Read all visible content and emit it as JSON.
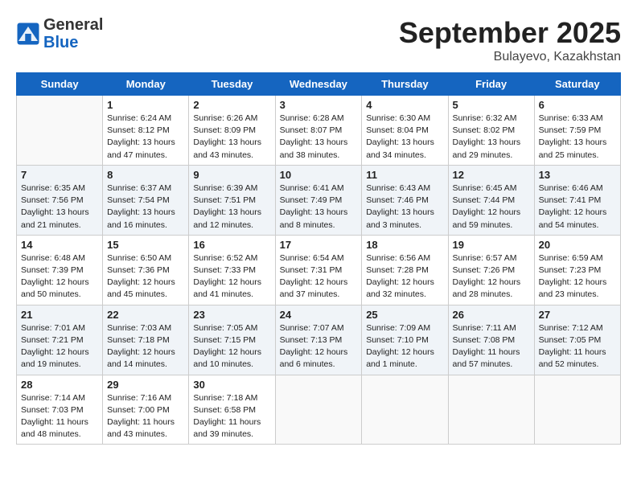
{
  "header": {
    "logo": {
      "general": "General",
      "blue": "Blue"
    },
    "title": "September 2025",
    "location": "Bulayevo, Kazakhstan"
  },
  "days_of_week": [
    "Sunday",
    "Monday",
    "Tuesday",
    "Wednesday",
    "Thursday",
    "Friday",
    "Saturday"
  ],
  "weeks": [
    [
      {
        "day": null,
        "info": null
      },
      {
        "day": "1",
        "sunrise": "Sunrise: 6:24 AM",
        "sunset": "Sunset: 8:12 PM",
        "daylight": "Daylight: 13 hours and 47 minutes."
      },
      {
        "day": "2",
        "sunrise": "Sunrise: 6:26 AM",
        "sunset": "Sunset: 8:09 PM",
        "daylight": "Daylight: 13 hours and 43 minutes."
      },
      {
        "day": "3",
        "sunrise": "Sunrise: 6:28 AM",
        "sunset": "Sunset: 8:07 PM",
        "daylight": "Daylight: 13 hours and 38 minutes."
      },
      {
        "day": "4",
        "sunrise": "Sunrise: 6:30 AM",
        "sunset": "Sunset: 8:04 PM",
        "daylight": "Daylight: 13 hours and 34 minutes."
      },
      {
        "day": "5",
        "sunrise": "Sunrise: 6:32 AM",
        "sunset": "Sunset: 8:02 PM",
        "daylight": "Daylight: 13 hours and 29 minutes."
      },
      {
        "day": "6",
        "sunrise": "Sunrise: 6:33 AM",
        "sunset": "Sunset: 7:59 PM",
        "daylight": "Daylight: 13 hours and 25 minutes."
      }
    ],
    [
      {
        "day": "7",
        "sunrise": "Sunrise: 6:35 AM",
        "sunset": "Sunset: 7:56 PM",
        "daylight": "Daylight: 13 hours and 21 minutes."
      },
      {
        "day": "8",
        "sunrise": "Sunrise: 6:37 AM",
        "sunset": "Sunset: 7:54 PM",
        "daylight": "Daylight: 13 hours and 16 minutes."
      },
      {
        "day": "9",
        "sunrise": "Sunrise: 6:39 AM",
        "sunset": "Sunset: 7:51 PM",
        "daylight": "Daylight: 13 hours and 12 minutes."
      },
      {
        "day": "10",
        "sunrise": "Sunrise: 6:41 AM",
        "sunset": "Sunset: 7:49 PM",
        "daylight": "Daylight: 13 hours and 8 minutes."
      },
      {
        "day": "11",
        "sunrise": "Sunrise: 6:43 AM",
        "sunset": "Sunset: 7:46 PM",
        "daylight": "Daylight: 13 hours and 3 minutes."
      },
      {
        "day": "12",
        "sunrise": "Sunrise: 6:45 AM",
        "sunset": "Sunset: 7:44 PM",
        "daylight": "Daylight: 12 hours and 59 minutes."
      },
      {
        "day": "13",
        "sunrise": "Sunrise: 6:46 AM",
        "sunset": "Sunset: 7:41 PM",
        "daylight": "Daylight: 12 hours and 54 minutes."
      }
    ],
    [
      {
        "day": "14",
        "sunrise": "Sunrise: 6:48 AM",
        "sunset": "Sunset: 7:39 PM",
        "daylight": "Daylight: 12 hours and 50 minutes."
      },
      {
        "day": "15",
        "sunrise": "Sunrise: 6:50 AM",
        "sunset": "Sunset: 7:36 PM",
        "daylight": "Daylight: 12 hours and 45 minutes."
      },
      {
        "day": "16",
        "sunrise": "Sunrise: 6:52 AM",
        "sunset": "Sunset: 7:33 PM",
        "daylight": "Daylight: 12 hours and 41 minutes."
      },
      {
        "day": "17",
        "sunrise": "Sunrise: 6:54 AM",
        "sunset": "Sunset: 7:31 PM",
        "daylight": "Daylight: 12 hours and 37 minutes."
      },
      {
        "day": "18",
        "sunrise": "Sunrise: 6:56 AM",
        "sunset": "Sunset: 7:28 PM",
        "daylight": "Daylight: 12 hours and 32 minutes."
      },
      {
        "day": "19",
        "sunrise": "Sunrise: 6:57 AM",
        "sunset": "Sunset: 7:26 PM",
        "daylight": "Daylight: 12 hours and 28 minutes."
      },
      {
        "day": "20",
        "sunrise": "Sunrise: 6:59 AM",
        "sunset": "Sunset: 7:23 PM",
        "daylight": "Daylight: 12 hours and 23 minutes."
      }
    ],
    [
      {
        "day": "21",
        "sunrise": "Sunrise: 7:01 AM",
        "sunset": "Sunset: 7:21 PM",
        "daylight": "Daylight: 12 hours and 19 minutes."
      },
      {
        "day": "22",
        "sunrise": "Sunrise: 7:03 AM",
        "sunset": "Sunset: 7:18 PM",
        "daylight": "Daylight: 12 hours and 14 minutes."
      },
      {
        "day": "23",
        "sunrise": "Sunrise: 7:05 AM",
        "sunset": "Sunset: 7:15 PM",
        "daylight": "Daylight: 12 hours and 10 minutes."
      },
      {
        "day": "24",
        "sunrise": "Sunrise: 7:07 AM",
        "sunset": "Sunset: 7:13 PM",
        "daylight": "Daylight: 12 hours and 6 minutes."
      },
      {
        "day": "25",
        "sunrise": "Sunrise: 7:09 AM",
        "sunset": "Sunset: 7:10 PM",
        "daylight": "Daylight: 12 hours and 1 minute."
      },
      {
        "day": "26",
        "sunrise": "Sunrise: 7:11 AM",
        "sunset": "Sunset: 7:08 PM",
        "daylight": "Daylight: 11 hours and 57 minutes."
      },
      {
        "day": "27",
        "sunrise": "Sunrise: 7:12 AM",
        "sunset": "Sunset: 7:05 PM",
        "daylight": "Daylight: 11 hours and 52 minutes."
      }
    ],
    [
      {
        "day": "28",
        "sunrise": "Sunrise: 7:14 AM",
        "sunset": "Sunset: 7:03 PM",
        "daylight": "Daylight: 11 hours and 48 minutes."
      },
      {
        "day": "29",
        "sunrise": "Sunrise: 7:16 AM",
        "sunset": "Sunset: 7:00 PM",
        "daylight": "Daylight: 11 hours and 43 minutes."
      },
      {
        "day": "30",
        "sunrise": "Sunrise: 7:18 AM",
        "sunset": "Sunset: 6:58 PM",
        "daylight": "Daylight: 11 hours and 39 minutes."
      },
      {
        "day": null,
        "info": null
      },
      {
        "day": null,
        "info": null
      },
      {
        "day": null,
        "info": null
      },
      {
        "day": null,
        "info": null
      }
    ]
  ]
}
